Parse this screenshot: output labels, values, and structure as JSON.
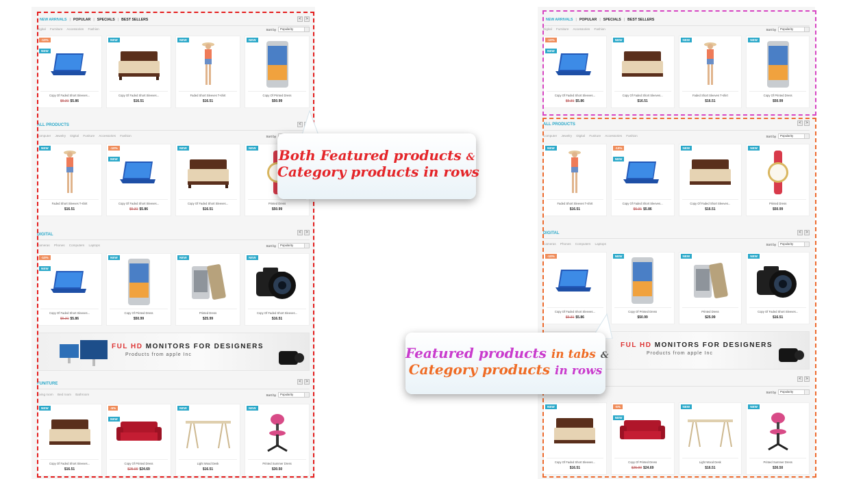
{
  "tabs": [
    "NEW ARRIVALS",
    "POPULAR",
    "SPECIALS",
    "BEST SELLERS"
  ],
  "featured_categories": [
    "Digital",
    "Furniture",
    "Accessories",
    "Fashion"
  ],
  "sort_label": "Sort by",
  "sort_value": "Popularity",
  "nav": {
    "prev": "<",
    "next": ">"
  },
  "badges": {
    "new": "NEW",
    "sale10": "-10%",
    "sale5": "-5%"
  },
  "sections": {
    "all_products": {
      "title": "ALL PRODUCTS",
      "categories": [
        "Computer",
        "Jewelry",
        "Digital",
        "Funiture",
        "Accessories",
        "Fashion"
      ]
    },
    "digital": {
      "title": "DIGITAL",
      "categories": [
        "Cameras",
        "Phones",
        "Computers",
        "Laptops"
      ]
    },
    "funiture": {
      "title": "FUNITURE",
      "categories": [
        "Living room",
        "Bed room",
        "Bathroom"
      ]
    }
  },
  "products": {
    "laptop": {
      "name": "Copy Of Faded Short Sleeves...",
      "old_price": "$6.31",
      "price": "$5.86"
    },
    "bed": {
      "name": "Copy Of Faded Short Sleeves...",
      "price": "$16.51"
    },
    "tshirt": {
      "name": "Faded Short Sleeves T-shirt",
      "price": "$16.51"
    },
    "phone": {
      "name": "Copy Of Printed Dress",
      "price": "$50.99"
    },
    "watch": {
      "name": "Printed Dress",
      "price": "$50.99"
    },
    "htc": {
      "name": "Printed Dress",
      "price": "$25.99"
    },
    "camera": {
      "name": "Copy Of Faded Short Sleeves...",
      "price": "$16.51"
    },
    "sofa": {
      "name": "Copy Of Printed Dress",
      "old_price": "$25.99",
      "price": "$24.69"
    },
    "desk": {
      "name": "Light Wood Desk",
      "price": "$16.51"
    },
    "chair": {
      "name": "Printed Summer Dress",
      "price": "$30.50"
    }
  },
  "banner": {
    "title_accent": "FUL HD",
    "title_rest": "MONITORS FOR DESIGNERS",
    "subtitle": "Products from apple Inc"
  },
  "callout_left": {
    "line1_a": "Both Featured products",
    "amp": "&",
    "line2": "Category products in rows"
  },
  "callout_right": {
    "a": "Featured products",
    "b": "in tabs",
    "amp": "&",
    "c": "Category products",
    "d": "in rows"
  },
  "colors": {
    "accent": "#2aa8c9",
    "dash_left": "#e41b1b",
    "dash_top_right": "#d744c2",
    "dash_bottom_right": "#ee6a2d",
    "callout_red": "#e42529",
    "callout_magenta": "#c93bcd",
    "callout_orange": "#ef6b24"
  }
}
